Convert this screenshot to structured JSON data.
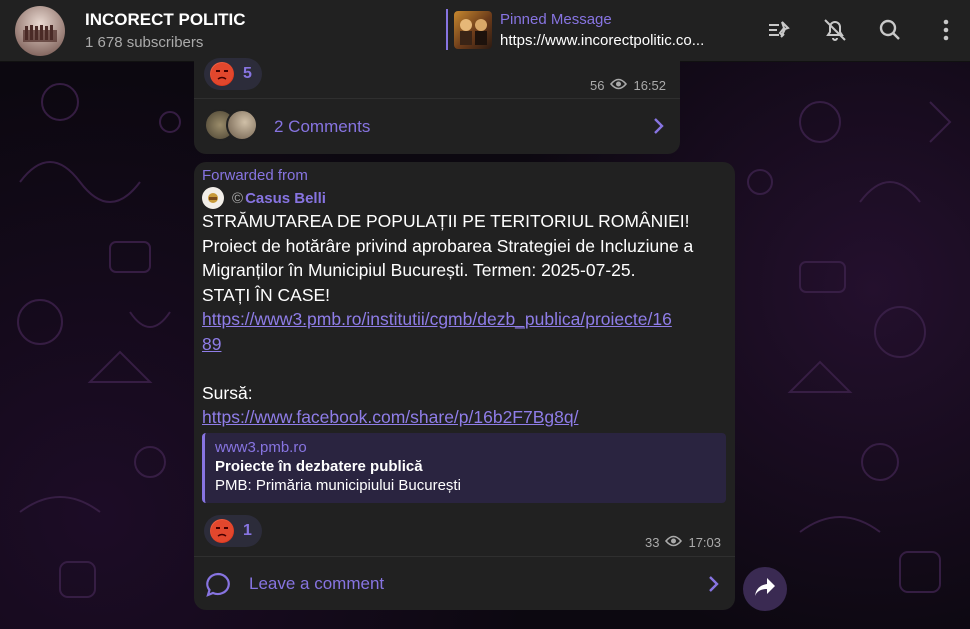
{
  "header": {
    "channel_title": "INCORECT POLITIC",
    "subscribers": "1 678 subscribers",
    "pinned_label": "Pinned Message",
    "pinned_text": "https://www.incorectpolitic.co..."
  },
  "prev_message": {
    "reaction_count": "5",
    "views": "56",
    "time": "16:52",
    "comments_label": "2 Comments"
  },
  "message": {
    "forwarded_label": "Forwarded from",
    "forwarded_source": "Casus Belli",
    "copyright_mark": "©",
    "text_line1": "STRĂMUTAREA DE POPULAȚII PE TERITORIUL ROMÂNIEI!",
    "text_line2": "Proiect de hotărâre privind aprobarea Strategiei de Incluziune a",
    "text_line3": "Migranților în Municipiul București. Termen: 2025-07-25.",
    "text_line4": "STAȚI ÎN CASE!",
    "link1_line1": "https://www3.pmb.ro/institutii/cgmb/dezb_publica/proiecte/16",
    "link1_line2": "89",
    "source_label": "Sursă:",
    "link2": "https://www.facebook.com/share/p/16b2F7Bg8q/",
    "preview": {
      "site": "www3.pmb.ro",
      "title": "Proiecte în dezbatere publică",
      "description": "PMB: Primăria municipiului București"
    },
    "reaction_count": "1",
    "views": "33",
    "time": "17:03",
    "leave_comment_label": "Leave a comment"
  },
  "icons": {
    "header": [
      "unpin-icon",
      "mute-bell-icon",
      "search-icon",
      "more-vertical-icon"
    ],
    "views": "eye-icon",
    "chevron": "chevron-right-icon",
    "comment": "comment-bubble-icon",
    "share": "share-arrow-icon"
  },
  "colors": {
    "accent": "#8774e1",
    "bubble": "#212121",
    "header": "#212121",
    "reaction_bg": "#2c2c3a"
  }
}
